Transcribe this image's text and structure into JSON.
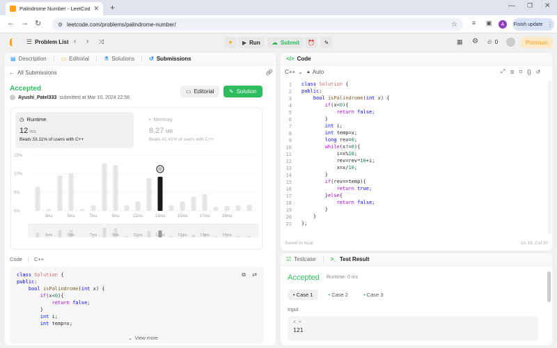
{
  "browser": {
    "tab_title": "Palindrome Number - LeetCode",
    "url": "leetcode.com/problems/palindrome-number/",
    "finish_update": "Finish update",
    "profile_initial": "A"
  },
  "header": {
    "problem_list": "Problem List",
    "run": "Run",
    "submit": "Submit",
    "fire_count": "0",
    "premium": "Premium"
  },
  "left": {
    "tabs": [
      "Description",
      "Editorial",
      "Solutions",
      "Submissions"
    ],
    "all_submissions": "All Submissions",
    "status": "Accepted",
    "user": "Ayushi_Patel333",
    "submitted": "submitted at Mar 10, 2024 22:56",
    "editorial_btn": "Editorial",
    "solution_btn": "Solution",
    "runtime_label": "Runtime",
    "runtime_value": "12",
    "runtime_unit": "ms",
    "runtime_beats": "Beats 33.11% of users with C++",
    "memory_label": "Memory",
    "memory_value": "8.27",
    "memory_unit": "MB",
    "memory_beats": "Beats 41.41% of users with C++",
    "code_tab": "Code",
    "lang_tab": "C++",
    "view_more": "View more",
    "code_lines": [
      "class Solution {",
      "public:",
      "    bool isPalindrome(int x) {",
      "        if(x<0){",
      "            return false;",
      "        }",
      "        int i;",
      "        int temp=x;"
    ]
  },
  "chart_data": {
    "type": "bar",
    "yticks": [
      "15%",
      "10%",
      "5%",
      "0%"
    ],
    "ylim": [
      0,
      15
    ],
    "xticks": [
      "3ms",
      "5ms",
      "7ms",
      "9ms",
      "11ms",
      "13ms",
      "15ms",
      "17ms",
      "19ms"
    ],
    "values": [
      6.5,
      0.5,
      9.5,
      10.2,
      0.5,
      1.5,
      12.8,
      12.3,
      1.5,
      2.5,
      8.8,
      9.2,
      1.5,
      2.5,
      3.8,
      4.5,
      1.0,
      1.3,
      1.5,
      1.6
    ],
    "highlight_index": 11,
    "mini_xticks": [
      "3ms",
      "5ms",
      "7ms",
      "9ms",
      "11ms",
      "13ms",
      "15ms",
      "17ms",
      "19ms"
    ]
  },
  "right": {
    "title": "Code",
    "lang": "C++",
    "auto": "Auto",
    "saved": "Saved to local",
    "cursor": "Ln 19, Col 10",
    "code_lines": [
      "class Solution {",
      "public:",
      "    bool isPalindrome(int x) {",
      "        if(x<0){",
      "            return false;",
      "        }",
      "        int i;",
      "        int temp=x;",
      "        long rev=0;",
      "        while(x!=0){",
      "            i=x%10;",
      "            rev=rev*10+i;",
      "            x=x/10;",
      "        }",
      "        if(rev==temp){",
      "            return true;",
      "        }else{",
      "            return false;",
      "        }",
      "    }",
      "};"
    ]
  },
  "bottom": {
    "tab_testcase": "Testcase",
    "tab_result": "Test Result",
    "status": "Accepted",
    "runtime": "Runtime: 0 ms",
    "cases": [
      "Case 1",
      "Case 2",
      "Case 3"
    ],
    "input_label": "Input",
    "var_label": "x =",
    "var_value": "121"
  },
  "colors": {
    "accent_green": "#2cbb5d",
    "bar": "#e5e5e5",
    "bar_highlight": "#1a1a1a",
    "premium": "#ffa116"
  }
}
